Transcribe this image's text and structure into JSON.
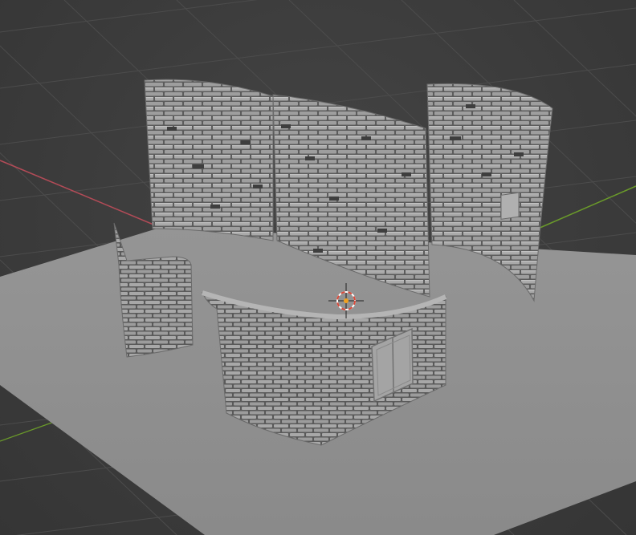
{
  "viewport": {
    "background": "#3d3d3d",
    "grid_color": "#4a4a4a",
    "x_axis_color": "#b24b57",
    "y_axis_color": "#6a9a2a",
    "ground_color": "#8f8f8f",
    "brick_color": "#a6a6a6",
    "mortar_color": "#5a5a5a",
    "cursor_color": "#d94a3a"
  },
  "objects": [
    {
      "name": "ground-plane-icon"
    },
    {
      "name": "back-wall-left"
    },
    {
      "name": "back-wall-middle"
    },
    {
      "name": "back-wall-right-curved"
    },
    {
      "name": "front-left-wall"
    },
    {
      "name": "front-right-wall-with-door"
    },
    {
      "name": "3d-cursor-icon"
    }
  ]
}
